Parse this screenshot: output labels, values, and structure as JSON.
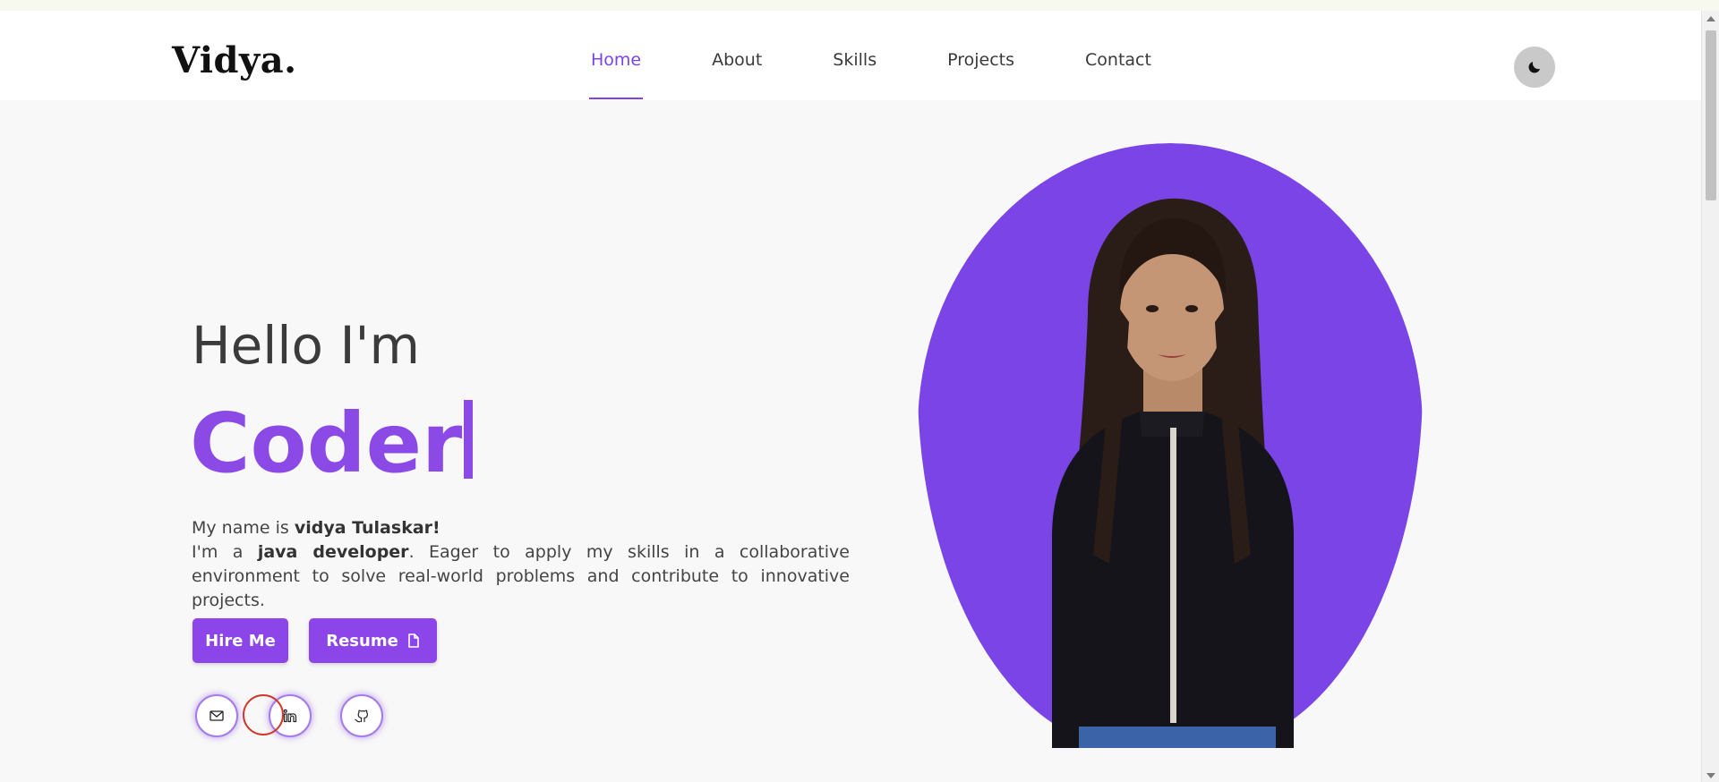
{
  "nav": {
    "logo": "Vidya.",
    "links": [
      {
        "label": "Home",
        "active": true
      },
      {
        "label": "About"
      },
      {
        "label": "Skills"
      },
      {
        "label": "Projects"
      },
      {
        "label": "Contact"
      }
    ],
    "theme_toggle_icon": "moon-icon"
  },
  "hero": {
    "greeting": "Hello I'm",
    "typed_role": "Coder",
    "bio": {
      "line1_prefix": "My name is ",
      "name": "vidya Tulaskar!",
      "line2_prefix": "I'm a ",
      "role": "java developer",
      "line2_suffix": ". Eager to apply my skills in a collaborative environment to solve real-world problems and contribute to innovative projects."
    },
    "buttons": {
      "hire": "Hire Me",
      "resume": "Resume"
    },
    "socials": [
      "mail-icon",
      "linkedin-icon",
      "github-icon"
    ],
    "photo_alt": "portrait of Vidya"
  },
  "colors": {
    "accent": "#8b45e8",
    "photo_bg": "#7a44e6",
    "page_bg": "#f8f8f8"
  }
}
